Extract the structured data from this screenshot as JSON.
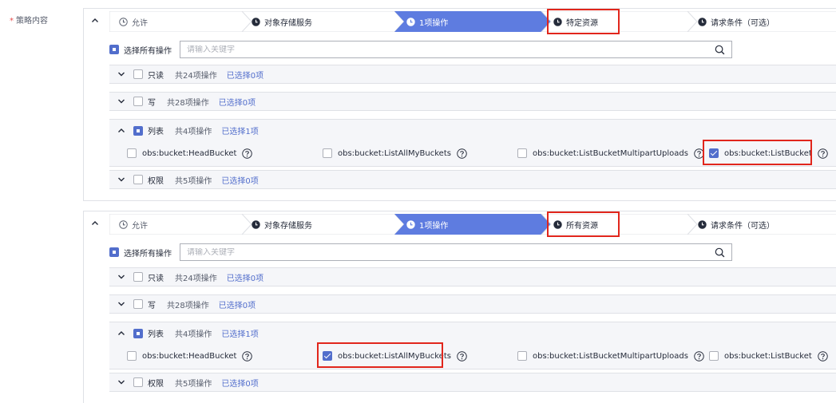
{
  "policy_label": "策略内容",
  "colors": {
    "primary": "#526ecc",
    "active_step": "#5e7ce0",
    "highlight": "#e1261c",
    "border": "#dfe1e6"
  },
  "panels": [
    {
      "steps": [
        "允许",
        "对象存储服务",
        "1项操作",
        "特定资源",
        "请求条件（可选）"
      ],
      "select_all_label": "选择所有操作",
      "search_placeholder": "请输入关键字",
      "groups": [
        {
          "label": "只读",
          "count": "共24项操作",
          "selected": "已选择0项"
        },
        {
          "label": "写",
          "count": "共28项操作",
          "selected": "已选择0项"
        },
        {
          "label": "列表",
          "count": "共4项操作",
          "selected": "已选择1项"
        },
        {
          "label": "权限",
          "count": "共5项操作",
          "selected": "已选择0项"
        }
      ],
      "actions": [
        "obs:bucket:HeadBucket",
        "obs:bucket:ListAllMyBuckets",
        "obs:bucket:ListBucketMultipartUploads",
        "obs:bucket:ListBucket"
      ],
      "checked_action": "obs:bucket:ListBucket"
    },
    {
      "steps": [
        "允许",
        "对象存储服务",
        "1项操作",
        "所有资源",
        "请求条件（可选）"
      ],
      "select_all_label": "选择所有操作",
      "search_placeholder": "请输入关键字",
      "groups": [
        {
          "label": "只读",
          "count": "共24项操作",
          "selected": "已选择0项"
        },
        {
          "label": "写",
          "count": "共28项操作",
          "selected": "已选择0项"
        },
        {
          "label": "列表",
          "count": "共4项操作",
          "selected": "已选择1项"
        },
        {
          "label": "权限",
          "count": "共5项操作",
          "selected": "已选择0项"
        }
      ],
      "actions": [
        "obs:bucket:HeadBucket",
        "obs:bucket:ListAllMyBuckets",
        "obs:bucket:ListBucketMultipartUploads",
        "obs:bucket:ListBucket"
      ],
      "checked_action": "obs:bucket:ListAllMyBuckets"
    }
  ]
}
